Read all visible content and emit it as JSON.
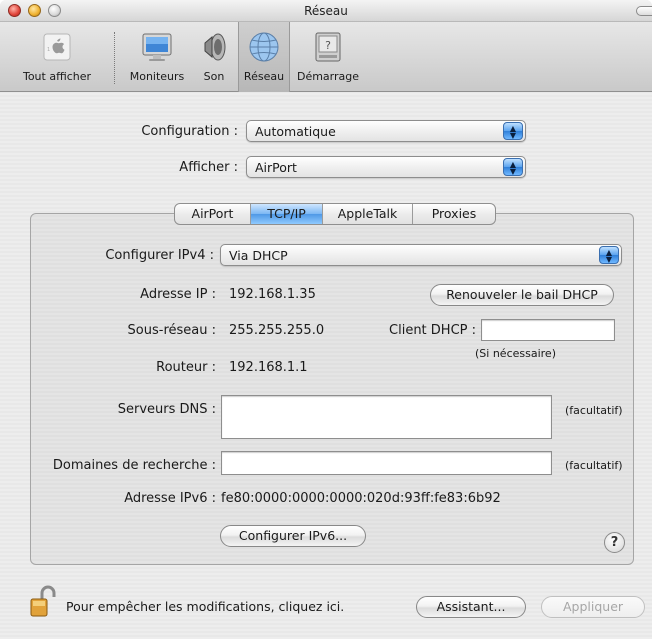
{
  "window": {
    "title": "Réseau"
  },
  "toolbar": {
    "items": [
      {
        "label": "Tout afficher",
        "icon": "apple-grid-icon"
      },
      {
        "label": "Moniteurs",
        "icon": "monitor-icon"
      },
      {
        "label": "Son",
        "icon": "speaker-icon"
      },
      {
        "label": "Réseau",
        "icon": "network-globe-icon",
        "selected": true
      },
      {
        "label": "Démarrage",
        "icon": "startup-disk-icon"
      }
    ]
  },
  "config": {
    "configuration_label": "Configuration :",
    "configuration_value": "Automatique",
    "afficher_label": "Afficher :",
    "afficher_value": "AirPort"
  },
  "tabs": [
    {
      "label": "AirPort"
    },
    {
      "label": "TCP/IP",
      "active": true
    },
    {
      "label": "AppleTalk"
    },
    {
      "label": "Proxies"
    }
  ],
  "tcpip": {
    "ipv4_label": "Configurer IPv4 :",
    "ipv4_value": "Via DHCP",
    "ip_label": "Adresse IP :",
    "ip_value": "192.168.1.35",
    "renew_button": "Renouveler le bail DHCP",
    "subnet_label": "Sous-réseau :",
    "subnet_value": "255.255.255.0",
    "dhcp_client_label": "Client DHCP :",
    "dhcp_client_value": "",
    "dhcp_hint": "(Si nécessaire)",
    "router_label": "Routeur :",
    "router_value": "192.168.1.1",
    "dns_label": "Serveurs DNS :",
    "dns_value": "",
    "optional_1": "(facultatif)",
    "search_label": "Domaines de recherche :",
    "search_value": "",
    "optional_2": "(facultatif)",
    "ipv6_label": "Adresse IPv6 :",
    "ipv6_value": "fe80:0000:0000:0000:020d:93ff:fe83:6b92",
    "configure_ipv6_button": "Configurer IPv6...",
    "help_symbol": "?"
  },
  "footer": {
    "lock_text": "Pour empêcher les modifications, cliquez ici.",
    "assistant_button": "Assistant...",
    "apply_button": "Appliquer"
  }
}
